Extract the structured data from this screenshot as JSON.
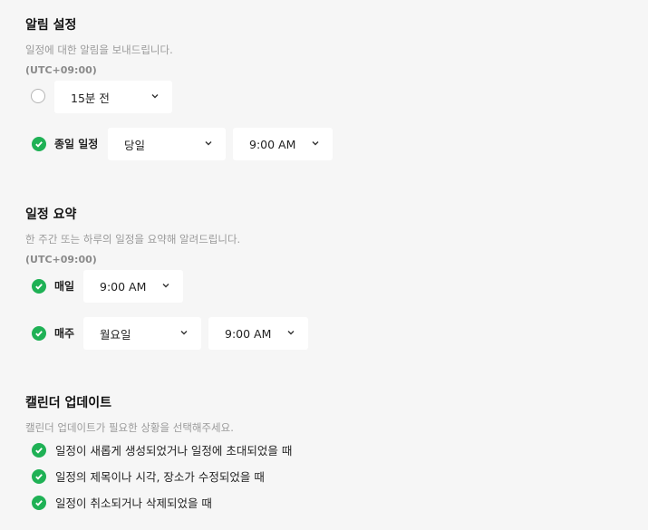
{
  "notification": {
    "title": "알림 설정",
    "description": "일정에 대한 알림을 보내드립니다.",
    "timezone": "(UTC+09:00)",
    "timed_event_select": "15분 전",
    "allday_label": "종일 일정",
    "allday_day_select": "당일",
    "allday_time_select": "9:00 AM"
  },
  "summary": {
    "title": "일정 요약",
    "description": "한 주간 또는 하루의 일정을 요약해 알려드립니다.",
    "timezone": "(UTC+09:00)",
    "daily_label": "매일",
    "daily_time_select": "9:00 AM",
    "weekly_label": "매주",
    "weekly_day_select": "월요일",
    "weekly_time_select": "9:00 AM"
  },
  "update": {
    "title": "캘린더 업데이트",
    "description": "캘린더 업데이트가 필요한 상황을 선택해주세요.",
    "options": [
      "일정이 새롭게 생성되었거나 일정에 초대되었을 때",
      "일정의 제목이나 시각, 장소가 수정되었을 때",
      "일정이 취소되거나 삭제되었을 때"
    ]
  },
  "colors": {
    "check": "#1fb155",
    "radio_border": "#b5b5b5"
  },
  "icons": {
    "check": "check-circle-icon",
    "radio": "radio-unchecked",
    "chevron": "chevron-down-icon"
  }
}
